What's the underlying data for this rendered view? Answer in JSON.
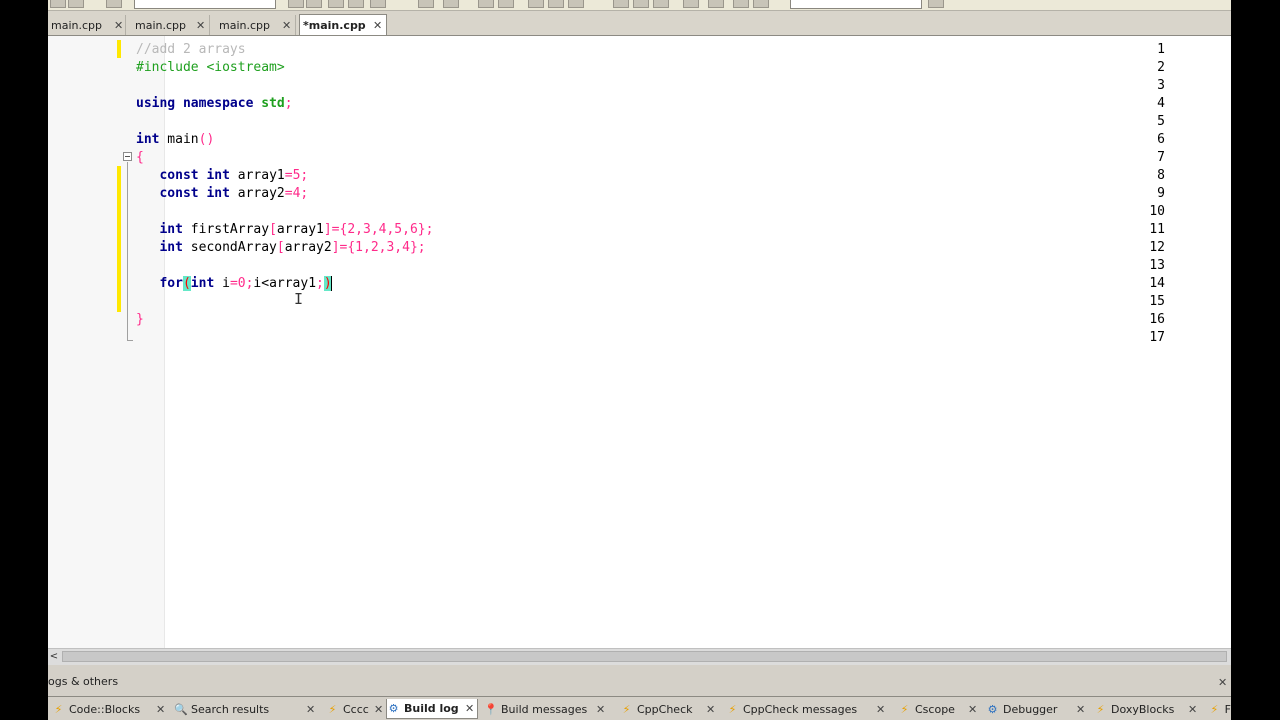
{
  "tabs": [
    {
      "label": "main.cpp",
      "close": "✕"
    },
    {
      "label": "main.cpp",
      "close": "✕"
    },
    {
      "label": "main.cpp",
      "close": "✕"
    },
    {
      "label": "*main.cpp",
      "close": "✕",
      "active": true
    }
  ],
  "line_numbers": [
    "1",
    "2",
    "3",
    "4",
    "5",
    "6",
    "7",
    "8",
    "9",
    "10",
    "11",
    "12",
    "13",
    "14",
    "15",
    "16",
    "17"
  ],
  "code": {
    "l1": "//add 2 arrays",
    "l2": "#include <iostream>",
    "l4_kw1": "using",
    "l4_kw2": "namespace",
    "l4_std": "std",
    "l4_semi": ";",
    "l6_kw": "int",
    "l6_name": " main",
    "l6_parens": "()",
    "l7": "{",
    "l8_kw1": "const",
    "l8_kw2": "int",
    "l8_name": " array1",
    "l8_eq": "=",
    "l8_num": "5",
    "l8_semi": ";",
    "l9_kw1": "const",
    "l9_kw2": "int",
    "l9_name": " array2",
    "l9_eq": "=",
    "l9_num": "4",
    "l9_semi": ";",
    "l11_kw": "int",
    "l11_name": " firstArray",
    "l11_b1": "[",
    "l11_idx": "array1",
    "l11_rest": "]={2,3,4,5,6};",
    "l12_kw": "int",
    "l12_name": " secondArray",
    "l12_b1": "[",
    "l12_idx": "array2",
    "l12_rest": "]={1,2,3,4};",
    "l14_kw": "for",
    "l14_open": "(",
    "l14_kw2": "int",
    "l14_i": " i",
    "l14_eq": "=",
    "l14_zero": "0",
    "l14_semi1": ";",
    "l14_cond": "i<array1",
    "l14_semi2": ";",
    "l14_close": ")",
    "l16": "}"
  },
  "ibeam": "I",
  "scroll_left": "<",
  "panel": {
    "title": "ogs & others",
    "pin": "✕"
  },
  "bottom_tabs": [
    {
      "icon": "⚡",
      "label": "Code::Blocks"
    },
    {
      "icon": "🔍",
      "label": "Search results"
    },
    {
      "icon": "⚡",
      "label": "Cccc"
    },
    {
      "icon": "⚙",
      "label": "Build log",
      "active": true
    },
    {
      "icon": "📍",
      "label": "Build messages"
    },
    {
      "icon": "⚡",
      "label": "CppCheck"
    },
    {
      "icon": "⚡",
      "label": "CppCheck messages"
    },
    {
      "icon": "⚡",
      "label": "Cscope"
    },
    {
      "icon": "⚙",
      "label": "Debugger"
    },
    {
      "icon": "⚡",
      "label": "DoxyBlocks"
    },
    {
      "icon": "⚡",
      "label": "F"
    }
  ],
  "bottom_close": "✕"
}
